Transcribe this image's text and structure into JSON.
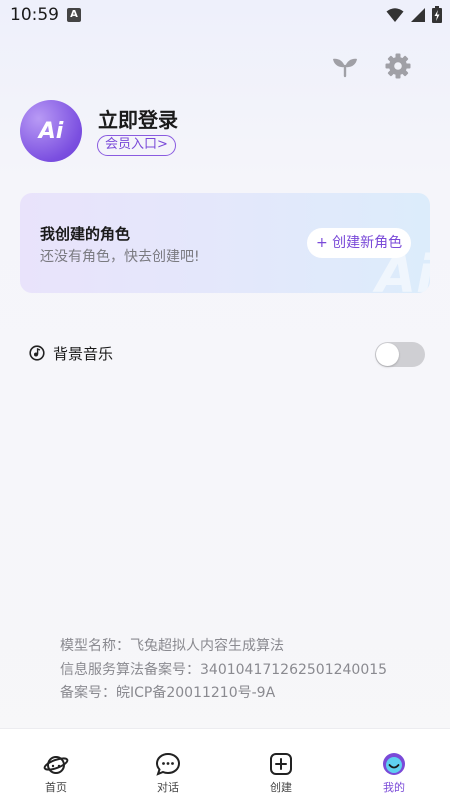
{
  "status_bar": {
    "time": "10:59",
    "notification_letter": "A"
  },
  "profile": {
    "avatar_text": "Ai",
    "login_title": "立即登录",
    "member_entry": "会员入口>"
  },
  "role_card": {
    "title": "我创建的角色",
    "subtitle": "还没有角色，快去创建吧!",
    "create_button": "+ 创建新角色",
    "watermark": "Ai"
  },
  "settings": {
    "background_music_label": "背景音乐",
    "background_music_on": false
  },
  "footer_info": {
    "model_name": "模型名称：飞兔超拟人内容生成算法",
    "filing_number": "信息服务算法备案号：340104171262501240015",
    "icp": "备案号：皖ICP备20011210号-9A"
  },
  "nav": {
    "items": [
      {
        "label": "首页",
        "icon": "planet-icon"
      },
      {
        "label": "对话",
        "icon": "chat-icon"
      },
      {
        "label": "创建",
        "icon": "plus-square-icon"
      },
      {
        "label": "我的",
        "icon": "smile-icon"
      }
    ],
    "active_index": 3
  },
  "colors": {
    "accent": "#7a4ad8",
    "toggle_off": "#cfcfd3"
  }
}
